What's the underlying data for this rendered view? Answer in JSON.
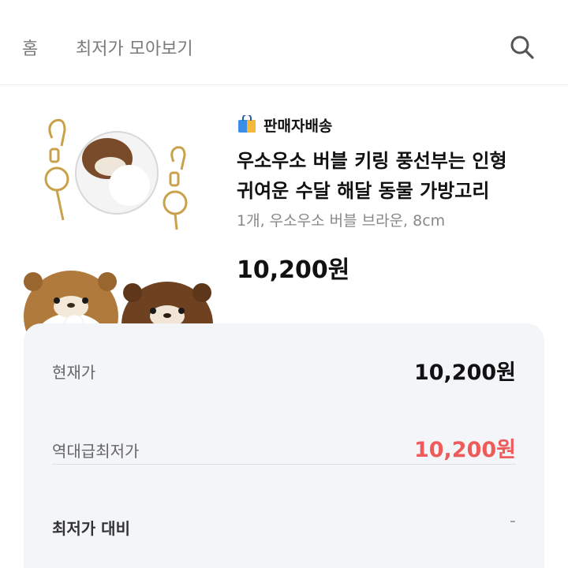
{
  "header": {
    "home_label": "홈",
    "title": "최저가 모아보기",
    "search_icon": "search-icon"
  },
  "product": {
    "seller_badge_icon": "shopping-bag-icon",
    "seller_label": "판매자배송",
    "name_line1": "우소우소 버블 키링 풍선부는 인형",
    "name_line2": "귀여운 수달 해달 동물 가방고리",
    "option": "1개, 우소우소 버블 브라운, 8cm",
    "price": "10,200원",
    "image_description": "otter-keyring-plush-image"
  },
  "price_card": {
    "current_label": "현재가",
    "current_value": "10,200원",
    "lowest_label": "역대급최저가",
    "lowest_value": "10,200원",
    "compare_label": "최저가 대비",
    "compare_value": "-",
    "lowest_color": "#ef5a5a"
  }
}
